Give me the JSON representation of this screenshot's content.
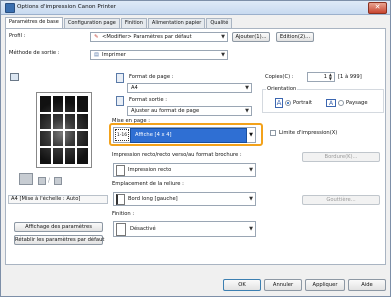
{
  "window": {
    "title": "Options d'impression Canon Printer"
  },
  "tabs": [
    {
      "label": "Paramètres de base"
    },
    {
      "label": "Configuration page"
    },
    {
      "label": "Finition"
    },
    {
      "label": "Alimentation papier"
    },
    {
      "label": "Qualité"
    }
  ],
  "profile": {
    "label": "Profil :",
    "value": "<Modifier> Paramètres par défaut",
    "add_label": "Ajouter(1)...",
    "edit_label": "Edition(2)..."
  },
  "output": {
    "label": "Méthode de sortie :",
    "value": "Imprimer"
  },
  "page_size": {
    "label": "Format de page :",
    "value": "A4"
  },
  "output_size": {
    "label": "Format sortie :",
    "value": "Ajuster au format de page"
  },
  "copies": {
    "label": "Copies(C) :",
    "value": "1",
    "range": "[1 à 999]"
  },
  "orientation": {
    "label": "Orientation",
    "portrait": "Portrait",
    "landscape": "Paysage"
  },
  "layout": {
    "label": "Mise en page :",
    "value": "Affiche [4 x 4]",
    "icon_text": "1-16",
    "border_label": "Limite d'impression(X)",
    "border_btn": "Bordure(K)..."
  },
  "duplex": {
    "label": "Impression recto/recto verso/au format brochure :",
    "value": "Impression recto"
  },
  "binding": {
    "label": "Emplacement de la reliure :",
    "value": "Bord long [gauche]",
    "gutter_btn": "Gouttière..."
  },
  "finishing": {
    "label": "Finition :",
    "value": "Désactivé"
  },
  "preview": {
    "caption": "A4 [Mise à l'échelle : Auto]"
  },
  "left_buttons": {
    "show_settings": "Affichage des paramètres",
    "restore": "Rétablir les paramètres par défaut"
  },
  "footer": {
    "ok": "OK",
    "cancel": "Annuler",
    "apply": "Appliquer",
    "help": "Aide"
  }
}
